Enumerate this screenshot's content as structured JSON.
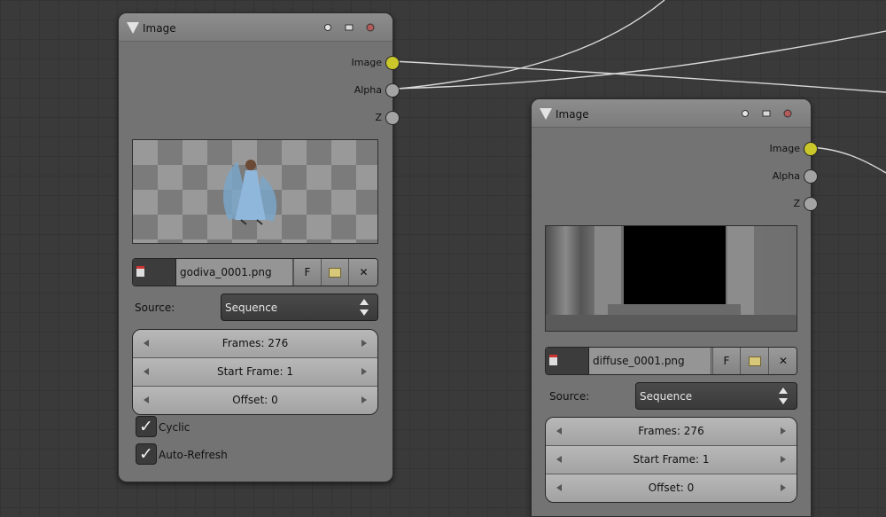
{
  "colors": {
    "canvas": "#3a3a3a",
    "node_body": "#737373",
    "socket_image": "#c9c72a",
    "socket_grey": "#a3a3a3",
    "link": "#d8d8d8"
  },
  "nodes": [
    {
      "title": "Image",
      "header_icons": [
        "circle-icon",
        "image-icon",
        "close-sphere-icon"
      ],
      "outputs": [
        "Image",
        "Alpha",
        "Z"
      ],
      "preview": "checkerboard-dancer-thumbnail",
      "file": {
        "name": "godiva_0001.png",
        "f_label": "F",
        "open_icon": "folder-icon",
        "clear_icon": "x-icon"
      },
      "source_label": "Source:",
      "source_value": "Sequence",
      "fields": [
        "Frames: 276",
        "Start Frame: 1",
        "Offset: 0"
      ],
      "checks": [
        {
          "label": "Cyclic",
          "checked": true
        },
        {
          "label": "Auto-Refresh",
          "checked": true
        }
      ]
    },
    {
      "title": "Image",
      "header_icons": [
        "circle-icon",
        "image-icon",
        "close-sphere-icon"
      ],
      "outputs": [
        "Image",
        "Alpha",
        "Z"
      ],
      "preview": "grey-texture-thumbnail",
      "file": {
        "name": "diffuse_0001.png",
        "f_label": "F",
        "open_icon": "folder-icon",
        "clear_icon": "x-icon"
      },
      "source_label": "Source:",
      "source_value": "Sequence",
      "fields": [
        "Frames: 276",
        "Start Frame: 1",
        "Offset: 0"
      ]
    }
  ]
}
